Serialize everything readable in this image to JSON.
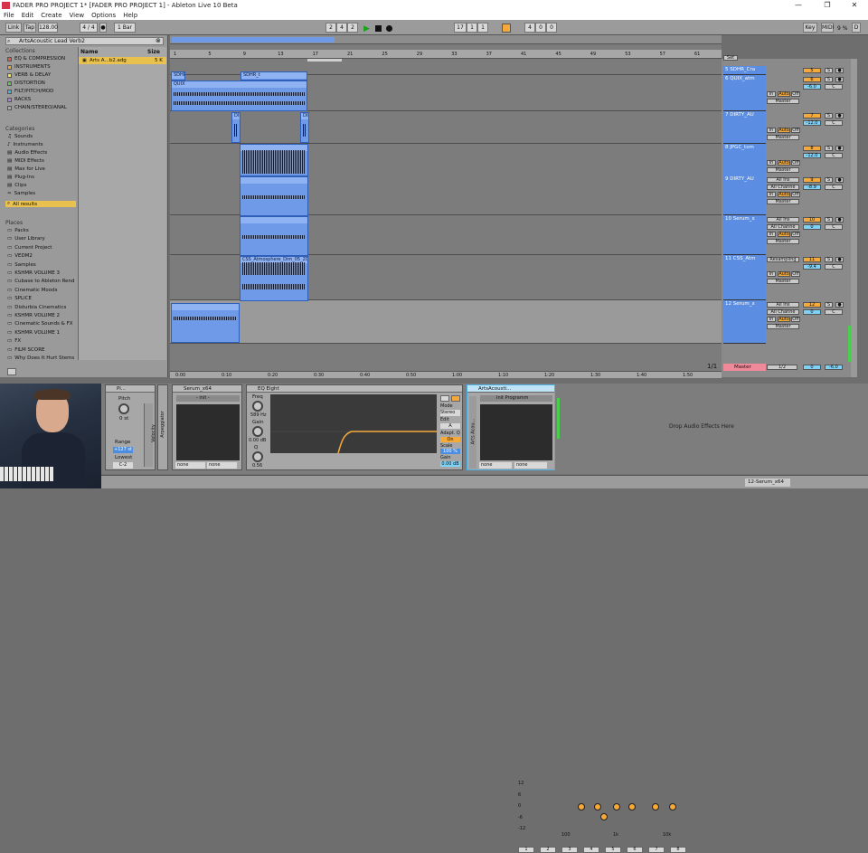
{
  "window": {
    "title": "FADER PRO PROJECT 1*  [FADER PRO PROJECT 1] - Ableton Live 10 Beta",
    "controls": [
      "—",
      "❐",
      "✕"
    ]
  },
  "menu": [
    "File",
    "Edit",
    "Create",
    "View",
    "Options",
    "Help"
  ],
  "transport": {
    "link": "Link",
    "tap": "Tap",
    "tempo": "128.00",
    "sig": "4 / 4",
    "metro": "1 Bar",
    "pos1": "2",
    "pos2": "4",
    "pos3": "2",
    "pos_b1": "17",
    "pos_b2": "1",
    "pos_b3": "1",
    "len1": "4",
    "len2": "0",
    "len3": "0",
    "key": "Key",
    "midi": "MIDI",
    "cpu": "9 %",
    "d": "D"
  },
  "browser": {
    "search": "ArtsAcoustic Lead Verb2",
    "collections_title": "Collections",
    "collections": [
      {
        "label": "EQ & COMPRESSION",
        "color": "#e4573b"
      },
      {
        "label": "INSTRUMENTS",
        "color": "#f0a03a"
      },
      {
        "label": "VERB & DELAY",
        "color": "#f3e03b"
      },
      {
        "label": "DISTORTION",
        "color": "#5ccb4b"
      },
      {
        "label": "FILT/PITCH/MOD",
        "color": "#3fb3e6"
      },
      {
        "label": "RACKS",
        "color": "#b07be0"
      },
      {
        "label": "CHAIN/STEREO/ANAL",
        "color": "#a8a8a8"
      }
    ],
    "categories_title": "Categories",
    "categories": [
      "Sounds",
      "Instruments",
      "Audio Effects",
      "MIDI Effects",
      "Max for Live",
      "Plug-Ins",
      "Clips",
      "Samples",
      "All results"
    ],
    "places_title": "Places",
    "places": [
      "Packs",
      "User Library",
      "Current Project",
      "VEDM2",
      "Samples",
      "KSHMR VOLUME 3",
      "Cubase to Ableton Rend",
      "Cinematic Moods",
      "SPLICE",
      "Disturbia Cinematics",
      "KSHMR VOLUME 2",
      "Cinematic Sounds & FX",
      "KSHMR VOLUME 1",
      "FX",
      "FILM SCORE",
      "Why Does It Hurt Stems"
    ],
    "col_name": "Name",
    "col_size": "Size",
    "file": {
      "name": "Arts A...b2.adg",
      "size": "5 K"
    }
  },
  "ruler": [
    "1",
    "5",
    "9",
    "13",
    "17",
    "21",
    "25",
    "29",
    "33",
    "37",
    "41",
    "45",
    "49",
    "53",
    "57",
    "61"
  ],
  "timebar": [
    "0:00",
    "0:10",
    "0:20",
    "0:30",
    "0:40",
    "0:50",
    "1:00",
    "1:10",
    "1:20",
    "1:30",
    "1:40",
    "1:50"
  ],
  "page_indicator": "1/1",
  "set_label": "Set",
  "tracks": [
    {
      "name": "5 SDHR_Cra",
      "num": "5",
      "vol": "0",
      "route": ""
    },
    {
      "name": "6 QUIX_atm",
      "num": "6",
      "vol": "-6.0",
      "route": "Master"
    },
    {
      "name": "7 DIRTY_AU",
      "num": "7",
      "vol": "-12.0",
      "route": "Master"
    },
    {
      "name": "8 JPGC_tom",
      "num": "8",
      "vol": "-12.0",
      "route": "Master"
    },
    {
      "name": "9 DIRTY_AU",
      "num": "9",
      "vol": "-8.9",
      "route": "Master"
    },
    {
      "name": "10 Serum_x",
      "num": "10",
      "vol": "0",
      "route": "Master"
    },
    {
      "name": "11 CSS_Atm",
      "num": "11",
      "vol": "-9.4",
      "route": "Master"
    },
    {
      "name": "12 Serum_x",
      "num": "12",
      "vol": "0",
      "route": "Master"
    }
  ],
  "track_labels": {
    "in": "In",
    "auto": "Auto",
    "off": "Off",
    "all_ins": "All Ins",
    "all_chan": "All Channe",
    "resampling": "Resampling",
    "s": "S"
  },
  "master": {
    "name": "Master",
    "route": "1/2",
    "vol": "0",
    "pan": "-6.0"
  },
  "clips": {
    "a": "SDHR_",
    "b": "QUIX",
    "c": "SDHR_t",
    "d": "DIR",
    "e": "CSS_Atmosphere_Dim_05_20"
  },
  "devices": {
    "pitch": {
      "title": "Pi...",
      "label": "Pitch",
      "val": "0 st",
      "range_label": "Range",
      "range": "+127 st",
      "lowest_label": "Lowest",
      "lowest": "C-2"
    },
    "velocity": "Velocity",
    "arpeggiator": "Arpeggiator",
    "serum": {
      "title": "Serum_x64",
      "preset": "- init -",
      "none": "none"
    },
    "eq": {
      "title": "EQ Eight",
      "freq_label": "Freq",
      "freq": "589 Hz",
      "gain_label": "Gain",
      "gain": "0.00 dB",
      "q_label": "Q",
      "q": "0.56",
      "mode_label": "Mode",
      "mode": "Stereo",
      "edit_label": "Edit",
      "edit": "A",
      "adapt_label": "Adapt. Q",
      "adapt": "On",
      "scale_label": "Scale",
      "scale": "100 %",
      "gain2_label": "Gain",
      "gain2": "0.00 dB",
      "db": [
        "12",
        "6",
        "0",
        "-6",
        "-12"
      ],
      "hz": [
        "100",
        "1k",
        "10k"
      ],
      "bands": [
        "1",
        "2",
        "3",
        "4",
        "5",
        "6",
        "7",
        "8"
      ]
    },
    "rack": {
      "title": "ArtsAcousti...",
      "preset": "Init Programm",
      "side": "Arts Acou...",
      "none": "none"
    },
    "drop": "Drop Audio Effects Here"
  },
  "status": {
    "track": "12-Serum_x64"
  }
}
